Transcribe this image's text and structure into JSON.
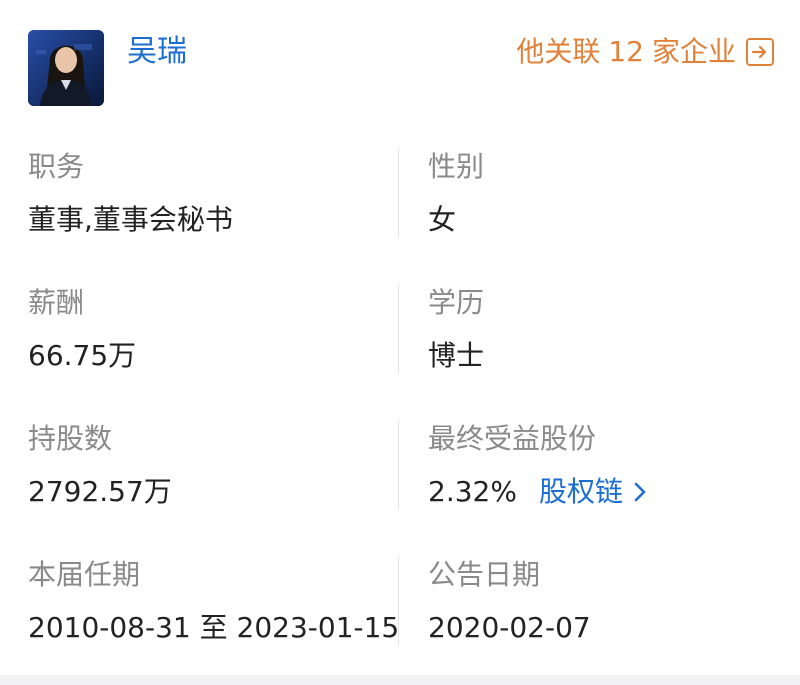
{
  "person": {
    "name": "吴瑞",
    "avatar_icon": "person-photo-icon"
  },
  "related": {
    "prefix": "他关联",
    "count": "12",
    "suffix": "家企业",
    "icon": "exit-arrow-icon"
  },
  "fields": {
    "position": {
      "label": "职务",
      "value": "董事,董事会秘书"
    },
    "gender": {
      "label": "性别",
      "value": "女"
    },
    "salary": {
      "label": "薪酬",
      "value": "66.75万"
    },
    "education": {
      "label": "学历",
      "value": "博士"
    },
    "shares": {
      "label": "持股数",
      "value": "2792.57万"
    },
    "beneficial": {
      "label": "最终受益股份",
      "value": "2.32%",
      "link": "股权链",
      "link_icon": "chevron-right-icon"
    },
    "term": {
      "label": "本届任期",
      "value": "2010-08-31 至 2023-01-15"
    },
    "announce": {
      "label": "公告日期",
      "value": "2020-02-07"
    }
  },
  "colors": {
    "link_blue": "#1c6fd0",
    "accent_orange": "#e0823a",
    "label_gray": "#8a8a8a",
    "text_dark": "#222222"
  }
}
